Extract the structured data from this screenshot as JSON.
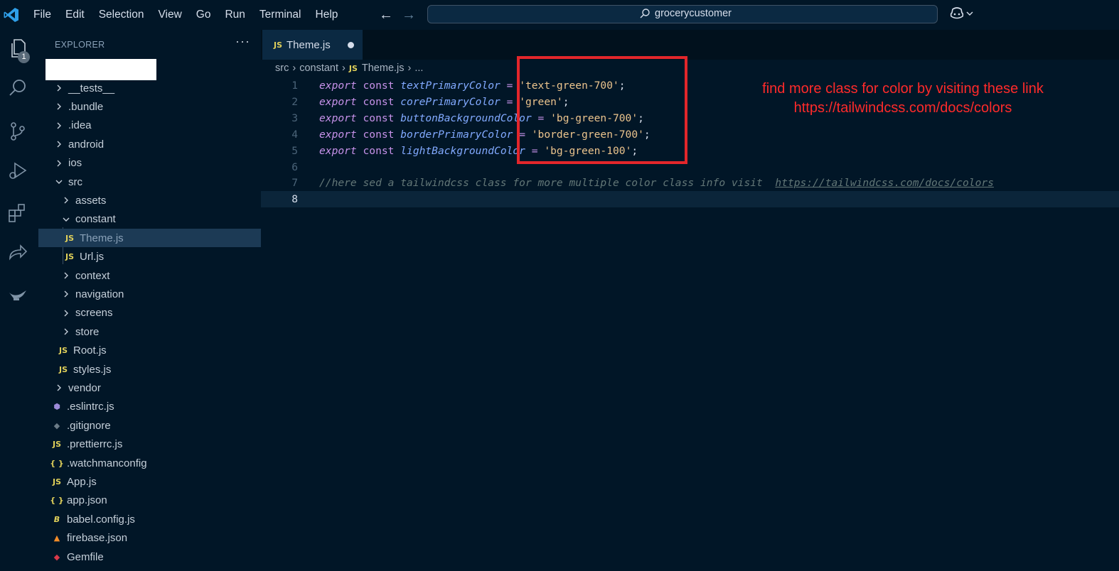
{
  "titlebar": {
    "menu": [
      "File",
      "Edit",
      "Selection",
      "View",
      "Go",
      "Run",
      "Terminal",
      "Help"
    ],
    "search_text": "grocerycustomer"
  },
  "activitybar": {
    "icons": [
      "explorer-icon",
      "search-icon",
      "source-control-icon",
      "run-debug-icon",
      "extensions-icon",
      "remote-icon",
      "genie-icon"
    ],
    "explorer_badge": "1"
  },
  "sidebar": {
    "title": "EXPLORER",
    "more": "···",
    "tree": [
      {
        "label": "__tests__",
        "type": "folder",
        "open": false,
        "depth": 0
      },
      {
        "label": ".bundle",
        "type": "folder",
        "open": false,
        "depth": 0
      },
      {
        "label": ".idea",
        "type": "folder",
        "open": false,
        "depth": 0
      },
      {
        "label": "android",
        "type": "folder",
        "open": false,
        "depth": 0
      },
      {
        "label": "ios",
        "type": "folder",
        "open": false,
        "depth": 0
      },
      {
        "label": "src",
        "type": "folder",
        "open": true,
        "depth": 0
      },
      {
        "label": "assets",
        "type": "folder",
        "open": false,
        "depth": 1
      },
      {
        "label": "constant",
        "type": "folder",
        "open": true,
        "depth": 1
      },
      {
        "label": "Theme.js",
        "type": "js",
        "depth": 2,
        "selected": true
      },
      {
        "label": "Url.js",
        "type": "js",
        "depth": 2
      },
      {
        "label": "context",
        "type": "folder",
        "open": false,
        "depth": 1
      },
      {
        "label": "navigation",
        "type": "folder",
        "open": false,
        "depth": 1
      },
      {
        "label": "screens",
        "type": "folder",
        "open": false,
        "depth": 1
      },
      {
        "label": "store",
        "type": "folder",
        "open": false,
        "depth": 1
      },
      {
        "label": "Root.js",
        "type": "js",
        "depth": 1
      },
      {
        "label": "styles.js",
        "type": "js",
        "depth": 1
      },
      {
        "label": "vendor",
        "type": "folder",
        "open": false,
        "depth": 0
      },
      {
        "label": ".eslintrc.js",
        "type": "eslint",
        "depth": 0
      },
      {
        "label": ".gitignore",
        "type": "git",
        "depth": 0
      },
      {
        "label": ".prettierrc.js",
        "type": "js",
        "depth": 0
      },
      {
        "label": ".watchmanconfig",
        "type": "json",
        "depth": 0
      },
      {
        "label": "App.js",
        "type": "js",
        "depth": 0
      },
      {
        "label": "app.json",
        "type": "json",
        "depth": 0
      },
      {
        "label": "babel.config.js",
        "type": "babel",
        "depth": 0
      },
      {
        "label": "firebase.json",
        "type": "firebase",
        "depth": 0
      },
      {
        "label": "Gemfile",
        "type": "ruby",
        "depth": 0
      }
    ]
  },
  "editor": {
    "tab": {
      "badge": "JS",
      "label": "Theme.js"
    },
    "breadcrumb": [
      "src",
      "constant",
      "Theme.js",
      "..."
    ],
    "lines": [
      [
        [
          "export",
          "kw"
        ],
        [
          " ",
          "punc"
        ],
        [
          "const",
          "kw2"
        ],
        [
          " ",
          "punc"
        ],
        [
          "textPrimaryColor",
          "var"
        ],
        [
          " = ",
          "op"
        ],
        [
          "'text-green-700'",
          "str"
        ],
        [
          ";",
          "punc"
        ]
      ],
      [
        [
          "export",
          "kw"
        ],
        [
          " ",
          "punc"
        ],
        [
          "const",
          "kw2"
        ],
        [
          " ",
          "punc"
        ],
        [
          "corePrimaryColor",
          "var"
        ],
        [
          " = ",
          "op"
        ],
        [
          "'green'",
          "str"
        ],
        [
          ";",
          "punc"
        ]
      ],
      [
        [
          "export",
          "kw"
        ],
        [
          " ",
          "punc"
        ],
        [
          "const",
          "kw2"
        ],
        [
          " ",
          "punc"
        ],
        [
          "buttonBackgroundColor",
          "var"
        ],
        [
          " = ",
          "op"
        ],
        [
          "'bg-green-700'",
          "str"
        ],
        [
          ";",
          "punc"
        ]
      ],
      [
        [
          "export",
          "kw"
        ],
        [
          " ",
          "punc"
        ],
        [
          "const",
          "kw2"
        ],
        [
          " ",
          "punc"
        ],
        [
          "borderPrimaryColor",
          "var"
        ],
        [
          " = ",
          "op"
        ],
        [
          "'border-green-700'",
          "str"
        ],
        [
          ";",
          "punc"
        ]
      ],
      [
        [
          "export",
          "kw"
        ],
        [
          " ",
          "punc"
        ],
        [
          "const",
          "kw2"
        ],
        [
          " ",
          "punc"
        ],
        [
          "lightBackgroundColor",
          "var"
        ],
        [
          " = ",
          "op"
        ],
        [
          "'bg-green-100'",
          "str"
        ],
        [
          ";",
          "punc"
        ]
      ],
      [],
      [
        [
          "//here sed a tailwindcss class for more multiple color class info visit  ",
          "cmt"
        ],
        [
          "https://tailwindcss.com/docs/colors",
          "cmt-link"
        ]
      ],
      []
    ],
    "active_line": 8
  },
  "annotation": {
    "line1": "find more class for color by visiting these link",
    "line2": "https://tailwindcss.com/docs/colors",
    "color": "#ff2a2a"
  }
}
